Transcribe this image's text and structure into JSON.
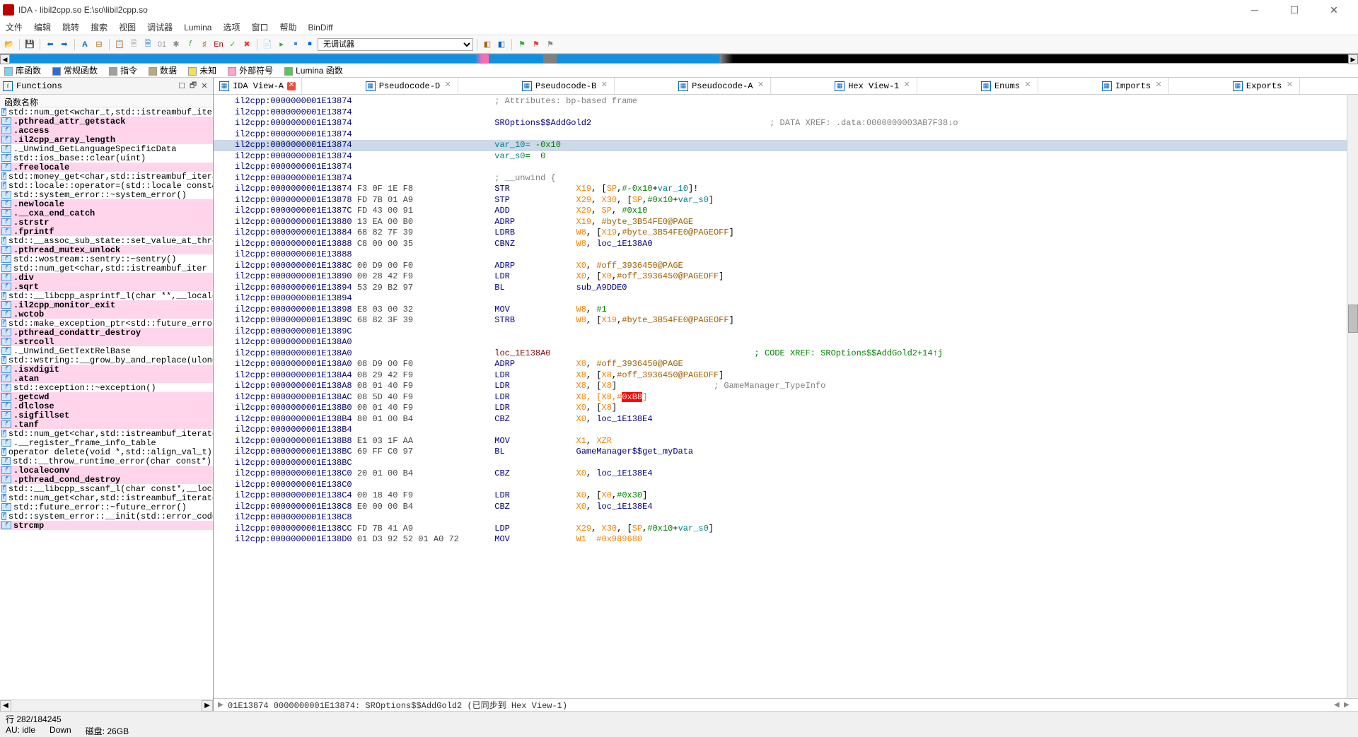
{
  "title": "IDA - libil2cpp.so E:\\so\\libil2cpp.so",
  "menu": [
    "文件",
    "编辑",
    "跳转",
    "搜索",
    "视图",
    "调试器",
    "Lumina",
    "选项",
    "窗口",
    "帮助",
    "BinDiff"
  ],
  "debugger_selected": "无调试器",
  "legend": [
    {
      "color": "#7ed0f7",
      "label": "库函数"
    },
    {
      "color": "#2b6cd6",
      "label": "常规函数"
    },
    {
      "color": "#a0a0a0",
      "label": "指令"
    },
    {
      "color": "#b6aa7e",
      "label": "数据"
    },
    {
      "color": "#efe05a",
      "label": "未知"
    },
    {
      "color": "#ffa5d2",
      "label": "外部符号"
    },
    {
      "color": "#55c855",
      "label": "Lumina 函数"
    }
  ],
  "functions_panel": {
    "title": "Functions",
    "col": "函数名称",
    "items": [
      {
        "t": "std::num_get<wchar_t,std::istreambuf_iter",
        "p": 0
      },
      {
        "t": ".pthread_attr_getstack",
        "p": 1
      },
      {
        "t": ".access",
        "p": 1
      },
      {
        "t": ".il2cpp_array_length",
        "p": 1
      },
      {
        "t": "._Unwind_GetLanguageSpecificData",
        "p": 0
      },
      {
        "t": "std::ios_base::clear(uint)",
        "p": 0
      },
      {
        "t": ".freelocale",
        "p": 1
      },
      {
        "t": "std::money_get<char,std::istreambuf_itera",
        "p": 0
      },
      {
        "t": "std::locale::operator=(std::locale const&)",
        "p": 0
      },
      {
        "t": "std::system_error::~system_error()",
        "p": 0
      },
      {
        "t": ".newlocale",
        "p": 1
      },
      {
        "t": ".__cxa_end_catch",
        "p": 1
      },
      {
        "t": ".strstr",
        "p": 1
      },
      {
        "t": ".fprintf",
        "p": 1
      },
      {
        "t": "std::__assoc_sub_state::set_value_at_thre",
        "p": 0
      },
      {
        "t": ".pthread_mutex_unlock",
        "p": 1
      },
      {
        "t": "std::wostream::sentry::~sentry()",
        "p": 0
      },
      {
        "t": "std::num_get<char,std::istreambuf_iter",
        "p": 0
      },
      {
        "t": ".div",
        "p": 1
      },
      {
        "t": ".sqrt",
        "p": 1
      },
      {
        "t": "std::__libcpp_asprintf_l(char **,__locale",
        "p": 0
      },
      {
        "t": ".il2cpp_monitor_exit",
        "p": 1
      },
      {
        "t": ".wctob",
        "p": 1
      },
      {
        "t": "std::make_exception_ptr<std::future_error",
        "p": 0
      },
      {
        "t": ".pthread_condattr_destroy",
        "p": 1
      },
      {
        "t": ".strcoll",
        "p": 1
      },
      {
        "t": "._Unwind_GetTextRelBase",
        "p": 0
      },
      {
        "t": "std::wstring::__grow_by_and_replace(ulong",
        "p": 0
      },
      {
        "t": ".isxdigit",
        "p": 1
      },
      {
        "t": ".atan",
        "p": 1
      },
      {
        "t": "std::exception::~exception()",
        "p": 0
      },
      {
        "t": ".getcwd",
        "p": 1
      },
      {
        "t": ".dlclose",
        "p": 1
      },
      {
        "t": ".sigfillset",
        "p": 1
      },
      {
        "t": ".tanf",
        "p": 1
      },
      {
        "t": "std::num_get<char,std::istreambuf_iterato",
        "p": 0
      },
      {
        "t": ".__register_frame_info_table",
        "p": 0
      },
      {
        "t": "operator delete(void *,std::align_val_t)",
        "p": 0
      },
      {
        "t": "std::__throw_runtime_error(char const*)",
        "p": 0
      },
      {
        "t": ".localeconv",
        "p": 1
      },
      {
        "t": ".pthread_cond_destroy",
        "p": 1
      },
      {
        "t": "std::__libcpp_sscanf_l(char const*,__loca",
        "p": 0
      },
      {
        "t": "std::num_get<char,std::istreambuf_iterato",
        "p": 0
      },
      {
        "t": "std::future_error::~future_error()",
        "p": 0
      },
      {
        "t": "std::system_error::__init(std::error_code",
        "p": 0
      },
      {
        "t": " strcmp",
        "p": 1
      }
    ]
  },
  "tabs": [
    {
      "label": "IDA View-A",
      "x": 1
    },
    {
      "label": "Pseudocode-D",
      "x": 0
    },
    {
      "label": "Pseudocode-B",
      "x": 0
    },
    {
      "label": "Pseudocode-A",
      "x": 0
    },
    {
      "label": "Hex View-1",
      "x": 0
    },
    {
      "label": "Enums",
      "x": 0
    },
    {
      "label": "Imports",
      "x": 0
    },
    {
      "label": "Exports",
      "x": 0
    }
  ],
  "lines": [
    {
      "dot": 0,
      "a": "il2cpp:0000000001E13874",
      "pre": "",
      "b": "",
      "mn": "",
      "op": "",
      "cmt": "; Attributes: bp-based frame"
    },
    {
      "dot": 0,
      "a": "il2cpp:0000000001E13874",
      "pre": "",
      "b": "",
      "mn": "",
      "op": ""
    },
    {
      "dot": 0,
      "a": "il2cpp:0000000001E13874",
      "pre": "",
      "b": "",
      "fn": "SROptions$$AddGold2",
      "xref": "; DATA XREF: .data:0000000003AB7F38↓o"
    },
    {
      "dot": 0,
      "a": "il2cpp:0000000001E13874",
      "pre": "",
      "b": "",
      "mn": "",
      "op": ""
    },
    {
      "dot": 0,
      "hl": 1,
      "a": "il2cpp:0000000001E13874",
      "pre": "",
      "b": "",
      "var": "var_10",
      "vv": "= -0x10"
    },
    {
      "dot": 0,
      "a": "il2cpp:0000000001E13874",
      "pre": "",
      "b": "",
      "var": "var_s0",
      "vv": "=  0"
    },
    {
      "dot": 0,
      "a": "il2cpp:0000000001E13874",
      "pre": "",
      "b": "",
      "mn": "",
      "op": ""
    },
    {
      "dot": 0,
      "a": "il2cpp:0000000001E13874",
      "pre": "",
      "b": "",
      "cmt": "; __unwind {"
    },
    {
      "dot": 1,
      "chev": 1,
      "a": "il2cpp:0000000001E13874",
      "b": "F3 0F 1E F8",
      "mn": "STR",
      "op": "X19, [SP,#-0x10+var_10]!",
      "k": 1
    },
    {
      "dot": 1,
      "a": "il2cpp:0000000001E13878",
      "b": "FD 7B 01 A9",
      "mn": "STP",
      "op": "X29, X30, [SP,#0x10+var_s0]",
      "k": 1
    },
    {
      "dot": 1,
      "a": "il2cpp:0000000001E1387C",
      "b": "FD 43 00 91",
      "mn": "ADD",
      "op": "X29, SP, #0x10",
      "k": 2
    },
    {
      "dot": 1,
      "a": "il2cpp:0000000001E13880",
      "b": "13 EA 00 B0",
      "mn": "ADRP",
      "op": "X19, #byte_3B54FE0@PAGE",
      "k": 3
    },
    {
      "dot": 1,
      "a": "il2cpp:0000000001E13884",
      "b": "68 82 7F 39",
      "mn": "LDRB",
      "op": "W8, [X19,#byte_3B54FE0@PAGEOFF]",
      "k": 3
    },
    {
      "dot": 1,
      "a": "il2cpp:0000000001E13888",
      "b": "C8 00 00 35",
      "mn": "CBNZ",
      "op": "W8, loc_1E138A0",
      "k": 4
    },
    {
      "dot": 0,
      "a": "il2cpp:0000000001E13888",
      "b": "",
      "mn": "",
      "op": ""
    },
    {
      "dot": 1,
      "a": "il2cpp:0000000001E1388C",
      "b": "00 D9 00 F0",
      "mn": "ADRP",
      "op": "X0, #off_3936450@PAGE",
      "k": 3
    },
    {
      "dot": 1,
      "a": "il2cpp:0000000001E13890",
      "b": "00 28 42 F9",
      "mn": "LDR",
      "op": "X0, [X0,#off_3936450@PAGEOFF]",
      "k": 3
    },
    {
      "dot": 1,
      "a": "il2cpp:0000000001E13894",
      "b": "53 29 B2 97",
      "mn": "BL",
      "op": "sub_A9DDE0",
      "k": 5
    },
    {
      "dot": 0,
      "a": "il2cpp:0000000001E13894",
      "b": "",
      "mn": "",
      "op": ""
    },
    {
      "dot": 1,
      "a": "il2cpp:0000000001E13898",
      "b": "E8 03 00 32",
      "mn": "MOV",
      "op": "W8, #1",
      "k": 2
    },
    {
      "dot": 1,
      "a": "il2cpp:0000000001E1389C",
      "b": "68 82 3F 39",
      "mn": "STRB",
      "op": "W8, [X19,#byte_3B54FE0@PAGEOFF]",
      "k": 3
    },
    {
      "dot": 0,
      "a": "il2cpp:0000000001E1389C",
      "b": "",
      "mn": "",
      "op": ""
    },
    {
      "dot": 0,
      "a": "il2cpp:0000000001E138A0",
      "b": "",
      "mn": "",
      "op": ""
    },
    {
      "dot": 0,
      "arrow": 1,
      "a": "il2cpp:0000000001E138A0",
      "b": "",
      "loc": "loc_1E138A0",
      "xref": "; CODE XREF: SROptions$$AddGold2+14↑j"
    },
    {
      "dot": 1,
      "a": "il2cpp:0000000001E138A0",
      "b": "08 D9 00 F0",
      "mn": "ADRP",
      "op": "X8, #off_3936450@PAGE",
      "k": 3
    },
    {
      "dot": 1,
      "a": "il2cpp:0000000001E138A4",
      "b": "08 29 42 F9",
      "mn": "LDR",
      "op": "X8, [X8,#off_3936450@PAGEOFF]",
      "k": 3
    },
    {
      "dot": 1,
      "a": "il2cpp:0000000001E138A8",
      "b": "08 01 40 F9",
      "mn": "LDR",
      "op": "X8, [X8]",
      "cmt2": "; GameManager_TypeInfo"
    },
    {
      "dot": 1,
      "a": "il2cpp:0000000001E138AC",
      "b": "08 5D 40 F9",
      "mn": "LDR",
      "op": "X8, [X8,#",
      "hi": "0xB8",
      "tail": "]"
    },
    {
      "dot": 1,
      "a": "il2cpp:0000000001E138B0",
      "b": "00 01 40 F9",
      "mn": "LDR",
      "op": "X0, [X8]"
    },
    {
      "dot": 1,
      "a": "il2cpp:0000000001E138B4",
      "b": "80 01 00 B4",
      "mn": "CBZ",
      "op": "X0, loc_1E138E4",
      "k": 4
    },
    {
      "dot": 0,
      "a": "il2cpp:0000000001E138B4",
      "b": "",
      "mn": "",
      "op": ""
    },
    {
      "dot": 1,
      "a": "il2cpp:0000000001E138B8",
      "b": "E1 03 1F AA",
      "mn": "MOV",
      "op": "X1, XZR"
    },
    {
      "dot": 1,
      "a": "il2cpp:0000000001E138BC",
      "b": "69 FF C0 97",
      "mn": "BL",
      "op": "GameManager$$get_myData",
      "k": 5
    },
    {
      "dot": 0,
      "a": "il2cpp:0000000001E138BC",
      "b": "",
      "mn": "",
      "op": ""
    },
    {
      "dot": 1,
      "a": "il2cpp:0000000001E138C0",
      "b": "20 01 00 B4",
      "mn": "CBZ",
      "op": "X0, loc_1E138E4",
      "k": 4
    },
    {
      "dot": 0,
      "a": "il2cpp:0000000001E138C0",
      "b": "",
      "mn": "",
      "op": ""
    },
    {
      "dot": 1,
      "a": "il2cpp:0000000001E138C4",
      "b": "00 18 40 F9",
      "mn": "LDR",
      "op": "X0, [X0,#0x30]",
      "k": 2
    },
    {
      "dot": 1,
      "a": "il2cpp:0000000001E138C8",
      "b": "E0 00 00 B4",
      "mn": "CBZ",
      "op": "X0, loc_1E138E4",
      "k": 4
    },
    {
      "dot": 0,
      "a": "il2cpp:0000000001E138C8",
      "b": "",
      "mn": "",
      "op": ""
    },
    {
      "dot": 1,
      "a": "il2cpp:0000000001E138CC",
      "b": "FD 7B 41 A9",
      "mn": "LDP",
      "op": "X29, X30, [SP,#0x10+var_s0]",
      "k": 1
    },
    {
      "dot": 1,
      "a": "il2cpp:0000000001E138D0",
      "b": "01 D3 92 52 01 A0 72",
      "mn1": "MOV",
      "op1": "W1  #0x989680",
      "k1": 2
    }
  ],
  "synced": "01E13874 0000000001E13874: SROptions$$AddGold2 (已同步到 Hex View-1)",
  "status1": "行 282/184245",
  "status2a": "AU:  idle",
  "status2b": "Down",
  "status2c": "磁盘: 26GB"
}
